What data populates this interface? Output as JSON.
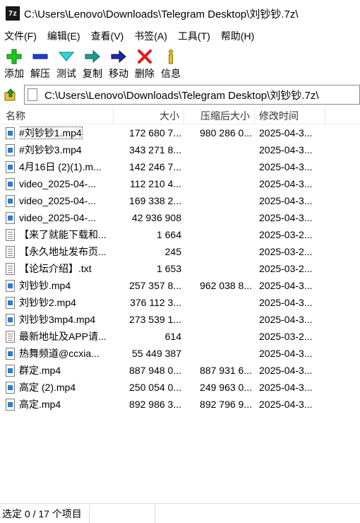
{
  "window": {
    "icon_text": "7z",
    "title": "C:\\Users\\Lenovo\\Downloads\\Telegram Desktop\\刘钞钞.7z\\"
  },
  "menu": [
    "文件(F)",
    "编辑(E)",
    "查看(V)",
    "书签(A)",
    "工具(T)",
    "帮助(H)"
  ],
  "toolbar": {
    "add": "添加",
    "extract": "解压",
    "test": "测试",
    "copy": "复制",
    "move": "移动",
    "delete": "删除",
    "info": "信息"
  },
  "address": {
    "path": "C:\\Users\\Lenovo\\Downloads\\Telegram Desktop\\刘钞钞.7z\\"
  },
  "columns": {
    "name": "名称",
    "size": "大小",
    "packed": "压缩后大小",
    "modified": "修改时间"
  },
  "files": [
    {
      "name": "#刘钞钞1.mp4",
      "size": "172 680 7...",
      "packed": "980 286 0...",
      "modified": "2025-04-3...",
      "type": "video"
    },
    {
      "name": "#刘钞钞3.mp4",
      "size": "343 271 8...",
      "packed": "",
      "modified": "2025-04-3...",
      "type": "video"
    },
    {
      "name": "4月16日 (2)(1).m...",
      "size": "142 246 7...",
      "packed": "",
      "modified": "2025-04-3...",
      "type": "video"
    },
    {
      "name": "video_2025-04-...",
      "size": "112 210 4...",
      "packed": "",
      "modified": "2025-04-3...",
      "type": "video"
    },
    {
      "name": "video_2025-04-...",
      "size": "169 338 2...",
      "packed": "",
      "modified": "2025-04-3...",
      "type": "video"
    },
    {
      "name": "video_2025-04-...",
      "size": "42 936 908",
      "packed": "",
      "modified": "2025-04-3...",
      "type": "video"
    },
    {
      "name": "【来了就能下载和...",
      "size": "1 664",
      "packed": "",
      "modified": "2025-03-2...",
      "type": "text"
    },
    {
      "name": "【永久地址发布页...",
      "size": "245",
      "packed": "",
      "modified": "2025-03-2...",
      "type": "text"
    },
    {
      "name": "【论坛介绍】.txt",
      "size": "1 653",
      "packed": "",
      "modified": "2025-03-2...",
      "type": "text"
    },
    {
      "name": "刘钞钞.mp4",
      "size": "257 357 8...",
      "packed": "962 038 8...",
      "modified": "2025-04-3...",
      "type": "video"
    },
    {
      "name": "刘钞钞2.mp4",
      "size": "376 112 3...",
      "packed": "",
      "modified": "2025-04-3...",
      "type": "video"
    },
    {
      "name": "刘钞钞3mp4.mp4",
      "size": "273 539 1...",
      "packed": "",
      "modified": "2025-04-3...",
      "type": "video"
    },
    {
      "name": "最新地址及APP请...",
      "size": "614",
      "packed": "",
      "modified": "2025-03-2...",
      "type": "text"
    },
    {
      "name": "热舞频道@ccxia...",
      "size": "55 449 387",
      "packed": "",
      "modified": "2025-04-3...",
      "type": "video"
    },
    {
      "name": "群定.mp4",
      "size": "887 948 0...",
      "packed": "887 931 6...",
      "modified": "2025-04-3...",
      "type": "video"
    },
    {
      "name": "高定 (2).mp4",
      "size": "250 054 0...",
      "packed": "249 963 0...",
      "modified": "2025-04-3...",
      "type": "video"
    },
    {
      "name": "高定.mp4",
      "size": "892 986 3...",
      "packed": "892 796 9...",
      "modified": "2025-04-3...",
      "type": "video"
    }
  ],
  "status": {
    "selected": "选定 0 / 17 个项目"
  }
}
